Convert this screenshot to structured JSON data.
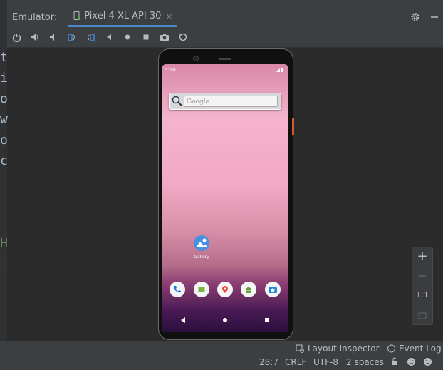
{
  "emulator": {
    "label": "Emulator:",
    "device_tab": "Pixel 4 XL API 30",
    "close": "×"
  },
  "editor": {
    "lines": [
      "t",
      "i",
      "o",
      "w",
      "o",
      "c",
      "H"
    ]
  },
  "phone": {
    "status_time": "5:10",
    "search_placeholder": "Google",
    "gallery_label": "Gallery"
  },
  "zoom": {
    "plus": "+",
    "minus": "−",
    "ratio": "1:1"
  },
  "tool_windows": {
    "layout_inspector": "Layout Inspector",
    "event_log": "Event Log"
  },
  "statusbar": {
    "position": "28:7",
    "line_sep": "CRLF",
    "encoding": "UTF-8",
    "indent": "2 spaces"
  }
}
